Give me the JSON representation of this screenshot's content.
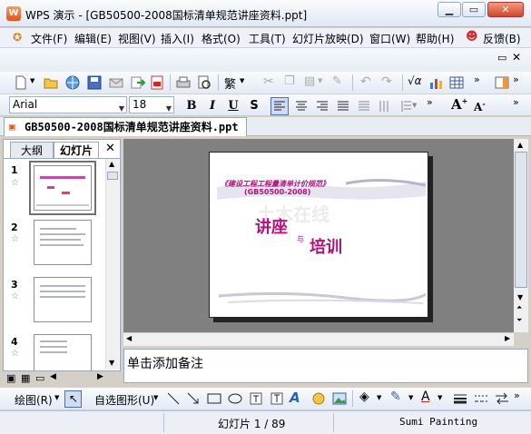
{
  "window": {
    "title": "WPS 演示 - [GB50500-2008国标清单规范讲座资料.ppt]",
    "app_icon_text": "W"
  },
  "menu": {
    "items": [
      "文件(F)",
      "编辑(E)",
      "视图(V)",
      "插入(I)",
      "格式(O)",
      "工具(T)",
      "幻灯片放映(D)",
      "窗口(W)",
      "帮助(H)"
    ],
    "feedback": "反馈(B)"
  },
  "format": {
    "font": "Arial",
    "size": "18",
    "traditional": "繁"
  },
  "document": {
    "tab_title": "GB50500-2008国标清单规范讲座资料.ppt"
  },
  "left_pane": {
    "tab_outline": "大纲",
    "tab_slides": "幻灯片",
    "slide_numbers": [
      "1",
      "2",
      "3",
      "4"
    ]
  },
  "slide": {
    "line1": "《建设工程工程量清单计价规范》",
    "line2": "(GB50500-2008)",
    "word1": "讲座",
    "connector": "与",
    "word2": "培训",
    "watermark": "土木在线",
    "accent_color": "#b0137a"
  },
  "notes": {
    "placeholder": "单击添加备注"
  },
  "drawing": {
    "draw_label": "绘图(R)",
    "autoshape_label": "自选图形(U)"
  },
  "status": {
    "slide_indicator": "幻灯片 1 / 89",
    "template": "Sumi Painting"
  }
}
